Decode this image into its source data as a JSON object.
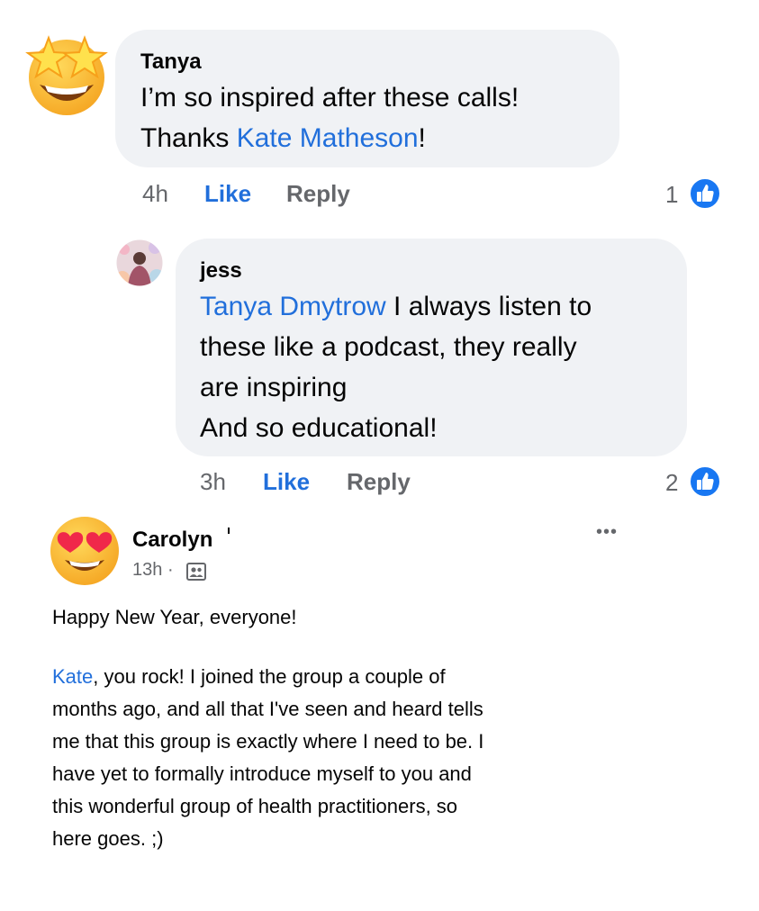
{
  "comment1": {
    "author": "Tanya",
    "line1": "I’m so inspired after these calls!",
    "line2_prefix": "Thanks ",
    "line2_link": "Kate Matheson",
    "line2_suffix": "!",
    "time": "4h",
    "like_label": "Like",
    "reply_label": "Reply",
    "like_count": "1"
  },
  "reply1": {
    "author": "jess",
    "mention": "Tanya Dmytrow",
    "line1_rest": " I always listen to",
    "line2": "these like a podcast, they really",
    "line3": "are inspiring",
    "line4": "And so educational!",
    "time": "3h",
    "like_label": "Like",
    "reply_label": "Reply",
    "like_count": "2"
  },
  "post": {
    "author": "Carolyn",
    "time": "13h",
    "separator": "·",
    "more_label": "•••",
    "paragraph1": "Happy New Year, everyone!",
    "p2_link": "Kate",
    "p2_line1_rest": ", you rock! I joined the group a couple of",
    "p2_line2": "months ago, and all that I've seen and heard tells",
    "p2_line3": "me that this group is exactly where I need to be. I",
    "p2_line4": "have yet to formally introduce myself to you and",
    "p2_line5": "this wonderful group of health practitioners, so",
    "p2_line6": "here goes. ;)"
  },
  "icons": {
    "avatar1": "star-struck-emoji-icon",
    "avatar2": "user-photo-avatar",
    "avatar3": "heart-eyes-emoji-icon",
    "like_badge": "thumbs-up-icon",
    "privacy": "group-privacy-icon",
    "more": "more-options-icon"
  },
  "colors": {
    "link": "#216fdb",
    "bubble": "#f0f2f5",
    "secondary_text": "#65676b",
    "like_badge": "#1877f2"
  }
}
